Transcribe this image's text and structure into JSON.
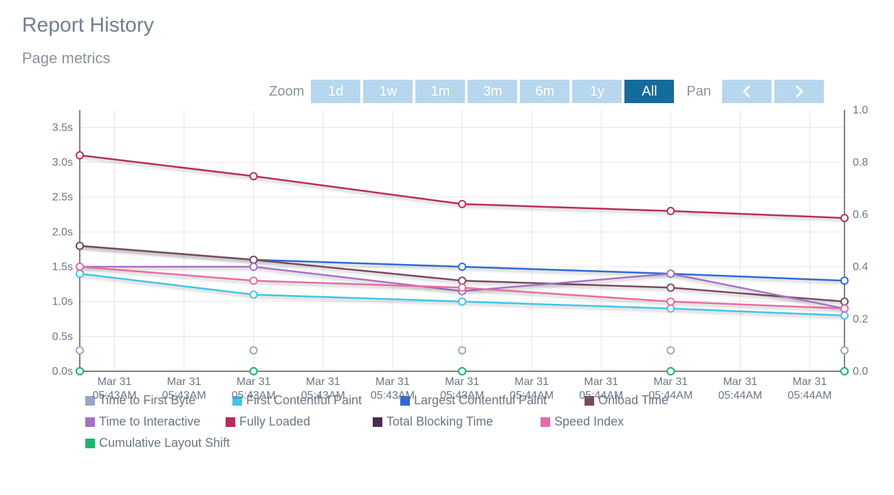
{
  "title": "Report History",
  "subtitle": "Page metrics",
  "toolbar": {
    "zoom_label": "Zoom",
    "zoom_options": [
      "1d",
      "1w",
      "1m",
      "3m",
      "6m",
      "1y",
      "All"
    ],
    "zoom_active": "All",
    "pan_label": "Pan"
  },
  "chart_data": {
    "type": "line",
    "x_categories": [
      "Mar 31 05:43AM",
      "Mar 31 05:43AM",
      "Mar 31 05:43AM",
      "Mar 31 05:43AM",
      "Mar 31 05:43AM",
      "Mar 31 05:43AM",
      "Mar 31 05:44AM",
      "Mar 31 05:44AM",
      "Mar 31 05:44AM",
      "Mar 31 05:44AM",
      "Mar 31 05:44AM"
    ],
    "data_x_indices": [
      -0.5,
      2,
      5,
      8,
      10.5
    ],
    "y_left": {
      "min": 0.0,
      "max": 3.75,
      "ticks": [
        0.0,
        0.5,
        1.0,
        1.5,
        2.0,
        2.5,
        3.0,
        3.5
      ],
      "unit": "s"
    },
    "y_right": {
      "min": 0.0,
      "max": 1.0,
      "ticks": [
        0.0,
        0.2,
        0.4,
        0.6,
        0.8,
        1.0
      ]
    },
    "series": [
      {
        "name": "Time to First Byte",
        "color": "#9aa5c9",
        "axis": "left",
        "values": [
          0.3,
          0.3,
          0.3,
          0.3,
          0.3
        ]
      },
      {
        "name": "First Contentful Paint",
        "color": "#3ec5e6",
        "axis": "left",
        "values": [
          1.4,
          1.1,
          1.0,
          0.9,
          0.8
        ]
      },
      {
        "name": "Largest Contentful Paint",
        "color": "#2f67d8",
        "axis": "left",
        "values": [
          1.8,
          1.6,
          1.5,
          1.4,
          1.3
        ]
      },
      {
        "name": "Onload Time",
        "color": "#7a4860",
        "axis": "left",
        "values": [
          1.8,
          1.6,
          1.3,
          1.2,
          1.0
        ]
      },
      {
        "name": "Time to Interactive",
        "color": "#a671c4",
        "axis": "left",
        "values": [
          1.5,
          1.5,
          1.15,
          1.4,
          0.9
        ]
      },
      {
        "name": "Fully Loaded",
        "color": "#b92a5b",
        "axis": "left",
        "values": [
          3.1,
          2.8,
          2.4,
          2.3,
          2.2
        ]
      },
      {
        "name": "Total Blocking Time",
        "color": "#4a2d55",
        "axis": "left",
        "values": [
          0.0,
          0.0,
          0.0,
          0.0,
          0.0
        ]
      },
      {
        "name": "Speed Index",
        "color": "#e86aa6",
        "axis": "left",
        "values": [
          1.5,
          1.3,
          1.2,
          1.0,
          0.9
        ]
      },
      {
        "name": "Cumulative Layout Shift",
        "color": "#1fb673",
        "axis": "right",
        "values": [
          0.0,
          0.0,
          0.0,
          0.0,
          0.0
        ]
      }
    ]
  }
}
